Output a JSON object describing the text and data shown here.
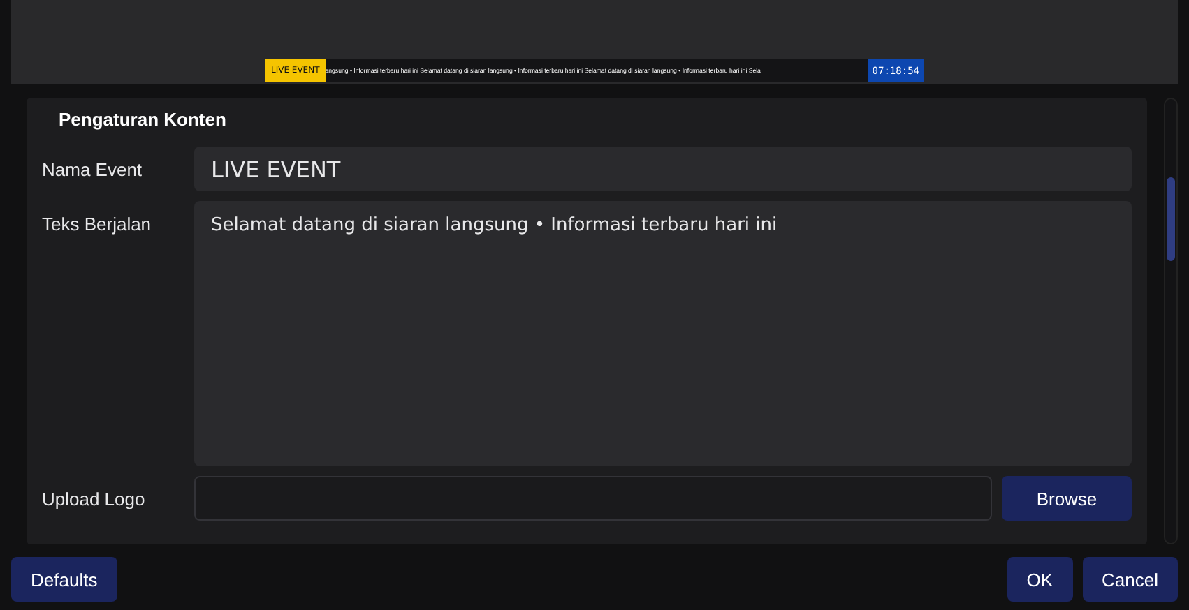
{
  "preview": {
    "ticker": {
      "badge": "LIVE EVENT",
      "text": "angsung • Informasi terbaru hari ini Selamat datang di siaran langsung • Informasi terbaru hari ini Selamat datang di siaran langsung • Informasi terbaru hari ini Sela",
      "clock": "07:18:54"
    }
  },
  "section": {
    "title": "Pengaturan Konten",
    "fields": [
      {
        "kind": "input",
        "label": "Nama Event",
        "value": "LIVE EVENT"
      },
      {
        "kind": "textarea",
        "label": "Teks Berjalan",
        "value": "Selamat datang di siaran langsung • Informasi terbaru hari ini"
      },
      {
        "kind": "file",
        "label": "Upload Logo",
        "button": "Browse"
      }
    ]
  },
  "buttons": {
    "left": [
      "Defaults"
    ],
    "right": [
      "OK",
      "Cancel"
    ]
  }
}
